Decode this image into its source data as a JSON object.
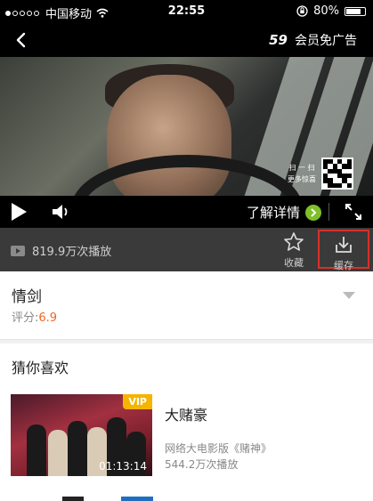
{
  "status_bar": {
    "carrier": "中国移动",
    "time": "22:55",
    "battery": "80%",
    "battery_level": 0.8
  },
  "header": {
    "ad_countdown": "59",
    "ad_label": "会员免广告"
  },
  "video": {
    "qr_caption_1": "扫 一 扫",
    "qr_caption_2": "更多惊喜"
  },
  "controls": {
    "learn_more": "了解详情"
  },
  "info_bar": {
    "play_count": "819.9万次播放",
    "favorite_label": "收藏",
    "cache_label": "缓存"
  },
  "movie": {
    "title": "情剑",
    "rating_label": "评分:",
    "rating_value": "6.9"
  },
  "recommend": {
    "section_title": "猜你喜欢",
    "items": [
      {
        "name": "大赌豪",
        "badge": "VIP",
        "duration": "01:13:14",
        "description": "网络大电影版《赌神》",
        "plays": "544.2万次播放"
      }
    ]
  },
  "colors": {
    "accent_orange": "#f26522",
    "highlight_red": "#d9302b",
    "vip_gold": "#f5b400",
    "go_green": "#7fbf2a"
  }
}
